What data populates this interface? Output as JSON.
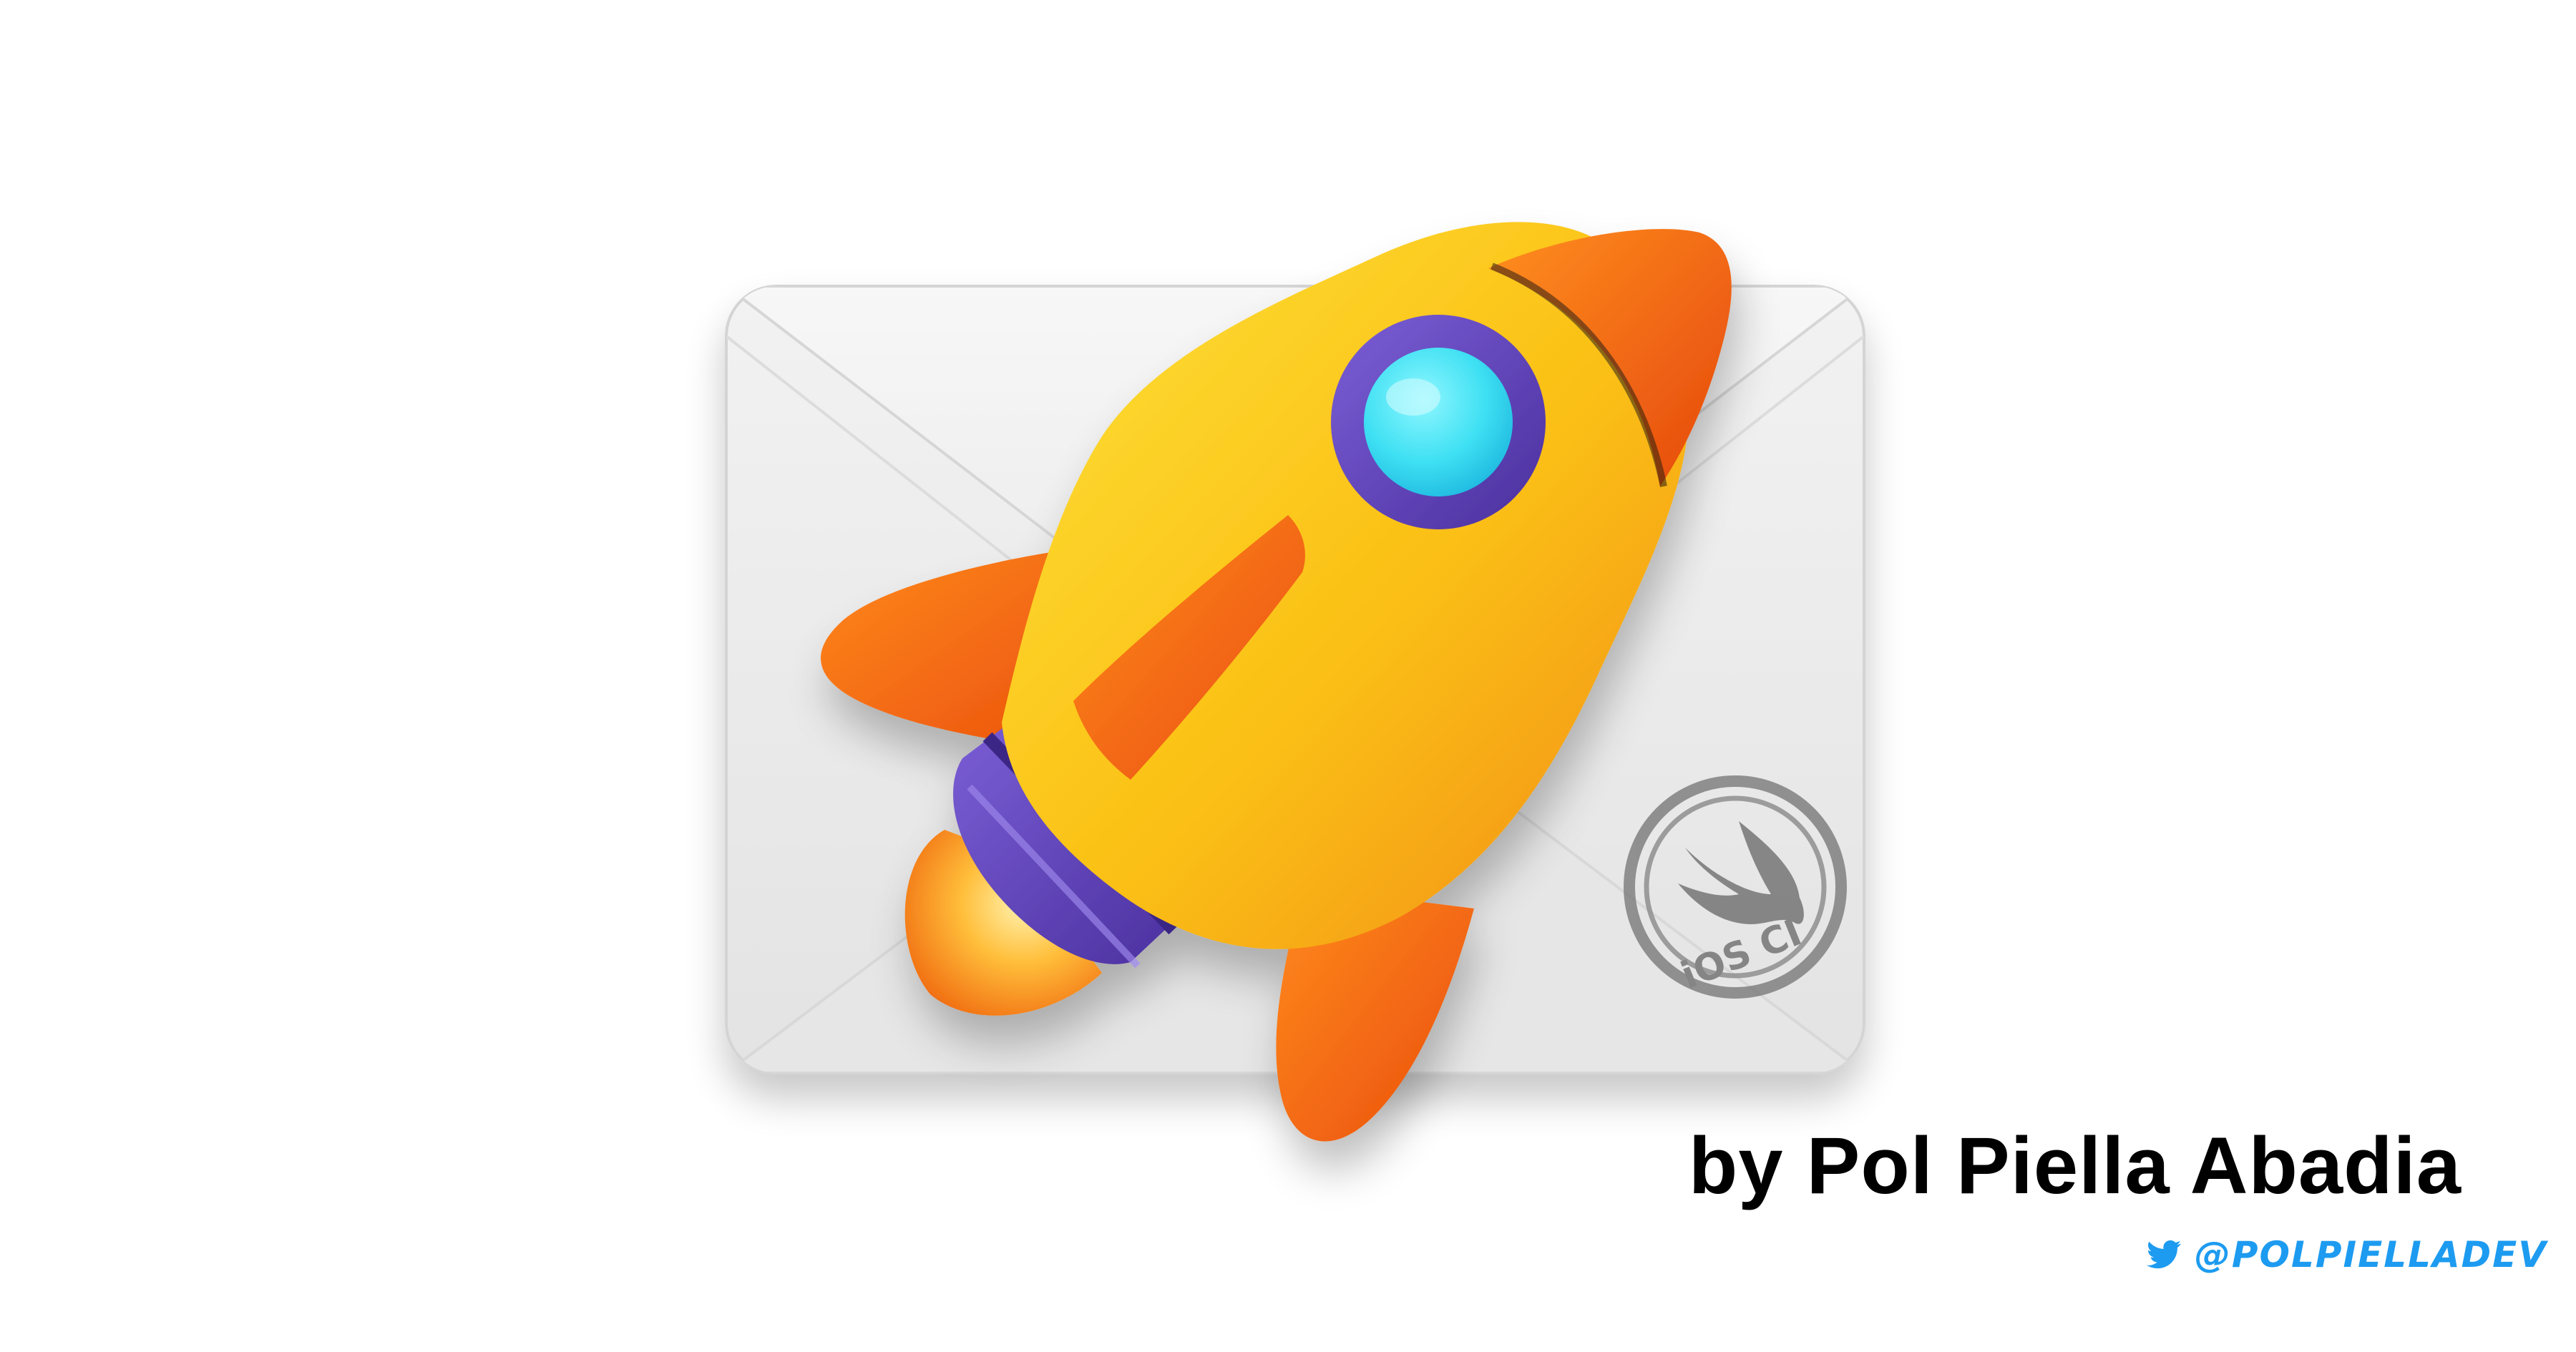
{
  "stamp": {
    "label": "iOS CI",
    "icon": "swift-bird-icon"
  },
  "author": {
    "byline": "by Pol Piella Abadia"
  },
  "social": {
    "icon": "twitter-bird-icon",
    "handle": "@POLPIELLADEV",
    "color": "#1d9bf0"
  },
  "colors": {
    "envelope": "#ececec",
    "rocket_body": "#fbbf14",
    "rocket_fins": "#f2670f",
    "window_ring": "#6a4fc4",
    "window_glass": "#42e6f5",
    "stamp_gray": "#7a7a7a"
  }
}
